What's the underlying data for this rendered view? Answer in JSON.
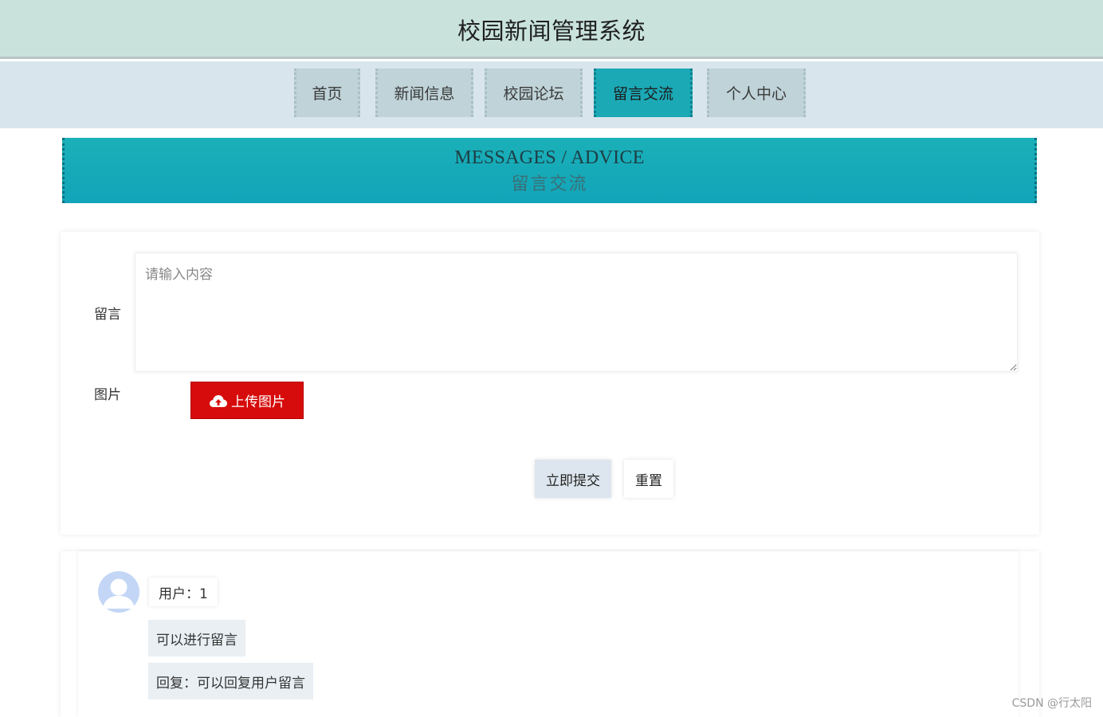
{
  "header": {
    "title": "校园新闻管理系统"
  },
  "nav": {
    "items": [
      {
        "label": "首页",
        "active": false
      },
      {
        "label": "新闻信息",
        "active": false
      },
      {
        "label": "校园论坛",
        "active": false
      },
      {
        "label": "留言交流",
        "active": true
      },
      {
        "label": "个人中心",
        "active": false
      }
    ]
  },
  "banner": {
    "title_en": "MESSAGES / ADVICE",
    "title_cn": "留言交流"
  },
  "form": {
    "message_label": "留言",
    "message_placeholder": "请输入内容",
    "message_value": "",
    "image_label": "图片",
    "upload_label": "上传图片",
    "submit_label": "立即提交",
    "reset_label": "重置"
  },
  "messages": [
    {
      "user": "用户：1",
      "content": "可以进行留言",
      "reply": "回复：可以回复用户留言"
    }
  ],
  "watermark": "CSDN @行太阳",
  "colors": {
    "header_bg": "#c9e3dc",
    "nav_bg": "#d9e5ec",
    "nav_active": "#1ba9b6",
    "banner": "#12a4b9",
    "upload_button": "#d60b0b"
  },
  "icons": {
    "upload": "cloud-upload-icon",
    "avatar": "user-avatar-icon"
  }
}
